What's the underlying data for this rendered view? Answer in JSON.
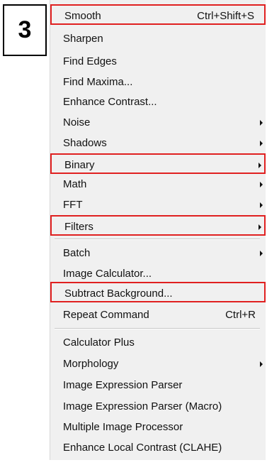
{
  "step_number": "3",
  "menu": {
    "items": [
      {
        "label": "Smooth",
        "shortcut": "Ctrl+Shift+S"
      },
      {
        "label": "Sharpen"
      },
      {
        "label": "Find Edges"
      },
      {
        "label": "Find Maxima..."
      },
      {
        "label": "Enhance Contrast..."
      },
      {
        "label": "Noise"
      },
      {
        "label": "Shadows"
      },
      {
        "label": "Binary"
      },
      {
        "label": "Math"
      },
      {
        "label": "FFT"
      },
      {
        "label": "Filters"
      },
      {
        "label": "Batch"
      },
      {
        "label": "Image Calculator..."
      },
      {
        "label": "Subtract Background..."
      },
      {
        "label": "Repeat Command",
        "shortcut": "Ctrl+R"
      },
      {
        "label": "Calculator Plus"
      },
      {
        "label": "Morphology"
      },
      {
        "label": "Image Expression Parser"
      },
      {
        "label": "Image Expression Parser (Macro)"
      },
      {
        "label": "Multiple Image Processor"
      },
      {
        "label": "Enhance Local Contrast (CLAHE)"
      }
    ]
  },
  "highlight_color": "#e02020",
  "icons": {
    "submenu": "submenu-arrow-icon"
  }
}
